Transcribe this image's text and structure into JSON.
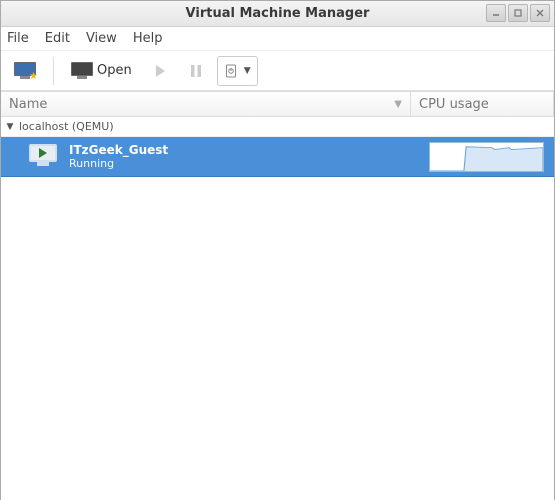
{
  "window": {
    "title": "Virtual Machine Manager"
  },
  "menubar": {
    "file": "File",
    "edit": "Edit",
    "view": "View",
    "help": "Help"
  },
  "toolbar": {
    "open_label": "Open"
  },
  "columns": {
    "name": "Name",
    "cpu": "CPU usage"
  },
  "hosts": [
    {
      "label": "localhost (QEMU)",
      "expanded": true,
      "vms": [
        {
          "name": "ITzGeek_Guest",
          "status": "Running",
          "selected": true
        }
      ]
    }
  ]
}
